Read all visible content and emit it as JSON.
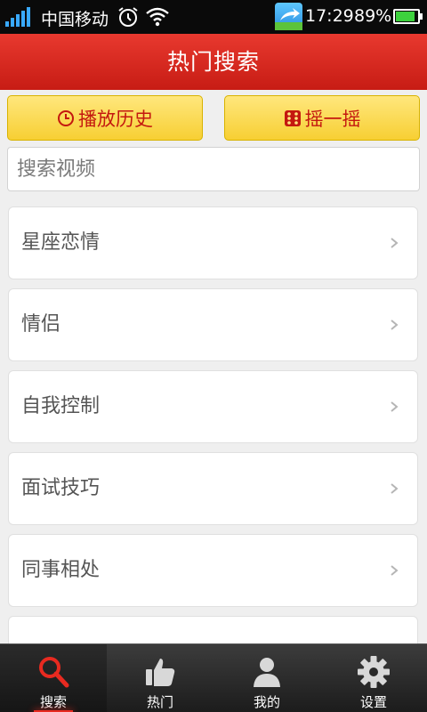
{
  "status_bar": {
    "carrier": "中国移动",
    "time": "17:29",
    "battery": "89%",
    "battery_level": 0.89,
    "signal_icon": "signal-icon",
    "alarm_icon": "alarm-clock-icon",
    "wifi_icon": "wifi-icon"
  },
  "header": {
    "title": "热门搜索"
  },
  "buttons": {
    "history_label": "播放历史",
    "history_icon": "clock-icon",
    "shake_label": "摇一摇",
    "shake_icon": "dice-icon"
  },
  "search": {
    "placeholder": "搜索视频",
    "value": ""
  },
  "list": {
    "items": [
      {
        "label": "星座恋情"
      },
      {
        "label": "情侣"
      },
      {
        "label": "自我控制"
      },
      {
        "label": "面试技巧"
      },
      {
        "label": "同事相处"
      },
      {
        "label": ""
      }
    ]
  },
  "tabbar": {
    "tabs": [
      {
        "label": "搜索",
        "icon": "search-icon",
        "active": true
      },
      {
        "label": "热门",
        "icon": "thumbs-up-icon",
        "active": false
      },
      {
        "label": "我的",
        "icon": "user-icon",
        "active": false
      },
      {
        "label": "设置",
        "icon": "gear-icon",
        "active": false
      }
    ]
  },
  "colors": {
    "header_red": "#d72a20",
    "button_yellow": "#f7cf33",
    "button_text": "#c4180f",
    "active_tab": "#e82a20"
  }
}
